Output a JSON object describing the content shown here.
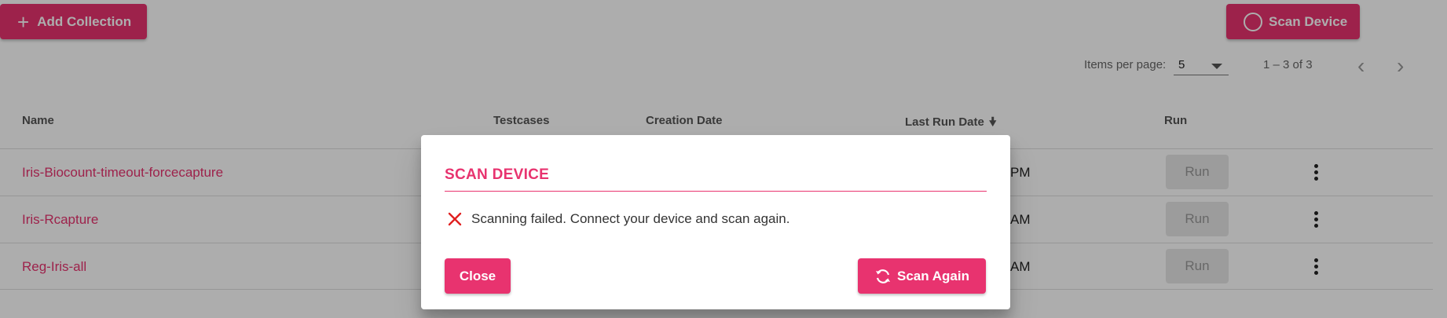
{
  "toolbar": {
    "add_collection_label": "Add Collection",
    "scan_device_label": "Scan Device"
  },
  "paginator": {
    "items_per_page_label": "Items per page:",
    "items_per_page_value": "5",
    "range_label": "1 – 3 of 3"
  },
  "table": {
    "headers": {
      "name": "Name",
      "testcases": "Testcases",
      "creation_date": "Creation Date",
      "last_run_date": "Last Run Date",
      "run": "Run"
    },
    "rows": [
      {
        "name": "Iris-Biocount-timeout-forcecapture",
        "last_run_visible": "PM",
        "run_label": "Run"
      },
      {
        "name": "Iris-Rcapture",
        "last_run_visible": "AM",
        "run_label": "Run"
      },
      {
        "name": "Reg-Iris-all",
        "last_run_visible": "AM",
        "run_label": "Run"
      }
    ]
  },
  "dialog": {
    "title": "SCAN DEVICE",
    "message": "Scanning failed. Connect your device and scan again.",
    "close_label": "Close",
    "scan_again_label": "Scan Again"
  },
  "colors": {
    "accent": "#e8336f",
    "error": "#e02020",
    "overlay": "rgba(0,0,0,0.32)"
  },
  "icons": {
    "add": "plus-icon",
    "scan": "circle-icon",
    "sort": "arrow-down-icon",
    "more": "more-vert-icon",
    "error": "close-icon",
    "refresh": "refresh-icon"
  }
}
